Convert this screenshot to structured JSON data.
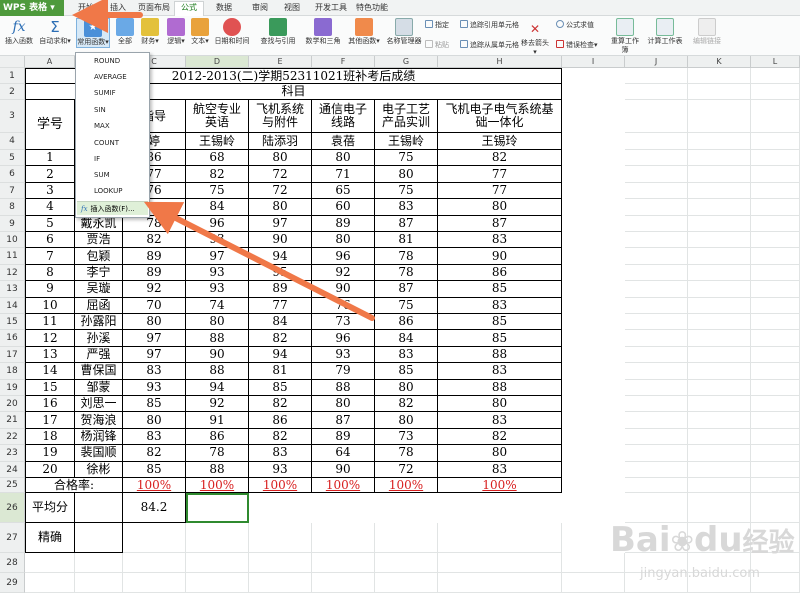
{
  "app": {
    "brand": "WPS 表格"
  },
  "menu_tabs": [
    "开始",
    "插入",
    "页面布局",
    "公式",
    "数据",
    "审阅",
    "视图",
    "开发工具",
    "特色功能"
  ],
  "active_tab": "公式",
  "ribbon": {
    "insert_fn": "插入函数",
    "autosum": "自动求和",
    "common_fn": "常用函数",
    "all_fn": "全部",
    "finance": "财务",
    "logic": "逻辑",
    "text": "文本",
    "datetime": "日期和时间",
    "lookup": "查找与引用",
    "math": "数学和三角",
    "other": "其他函数",
    "name_mgr": "名称管理器",
    "specify": "指定",
    "paste": "粘贴",
    "trace_prec": "追踪引用单元格",
    "trace_dep": "追踪从属单元格",
    "remove_arrows": "移去箭头",
    "show_formula": "公式求值",
    "error_check": "错误检查",
    "recalc": "重算工作簿",
    "calc_sheet": "计算工作表",
    "edit_link": "编辑链接"
  },
  "dropdown": {
    "items": [
      "ROUND",
      "AVERAGE",
      "SUMIF",
      "SIN",
      "MAX",
      "COUNT",
      "IF",
      "SUM",
      "LOOKUP"
    ],
    "insert_label": "插入函数(F)...",
    "fx": "fx"
  },
  "columns": [
    "A",
    "B",
    "C",
    "D",
    "E",
    "F",
    "G",
    "H",
    "I",
    "J",
    "K",
    "L"
  ],
  "rows": [
    "1",
    "2",
    "3",
    "4",
    "5",
    "6",
    "7",
    "8",
    "9",
    "10",
    "11",
    "12",
    "13",
    "14",
    "15",
    "16",
    "17",
    "18",
    "19",
    "20",
    "21",
    "22",
    "23",
    "24",
    "25",
    "26",
    "27",
    "28",
    "29"
  ],
  "sheet": {
    "title": "2012-2013(二)学期52311021班补考后成绩",
    "subject": "科目",
    "student_no": "学号",
    "c3": "指导",
    "c4": "婷",
    "subjects": [
      "航空专业\n英语",
      "飞机系统\n与附件",
      "通信电子\n线路",
      "电子工艺\n产品实训",
      "飞机电子电气系统基\n础一体化"
    ],
    "teachers": [
      "王锡岭",
      "陆添羽",
      "袁蓓",
      "王锡岭",
      "王锡玲"
    ],
    "data": [
      {
        "no": "1",
        "name": "",
        "c": "86",
        "d": "68",
        "e": "80",
        "f": "80",
        "g": "75",
        "h": "82"
      },
      {
        "no": "2",
        "name": "",
        "c": "77",
        "d": "82",
        "e": "72",
        "f": "71",
        "g": "80",
        "h": "77"
      },
      {
        "no": "3",
        "name": "",
        "c": "76",
        "d": "75",
        "e": "72",
        "f": "65",
        "g": "75",
        "h": "77"
      },
      {
        "no": "4",
        "name": "",
        "c": "",
        "d": "84",
        "e": "80",
        "f": "60",
        "g": "83",
        "h": "80"
      },
      {
        "no": "5",
        "name": "戴永凯",
        "c": "78",
        "d": "96",
        "e": "97",
        "f": "89",
        "g": "87",
        "h": "87"
      },
      {
        "no": "6",
        "name": "贾浩",
        "c": "82",
        "d": "93",
        "e": "90",
        "f": "80",
        "g": "81",
        "h": "83"
      },
      {
        "no": "7",
        "name": "包颖",
        "c": "89",
        "d": "97",
        "e": "94",
        "f": "96",
        "g": "78",
        "h": "90"
      },
      {
        "no": "8",
        "name": "李宁",
        "c": "89",
        "d": "93",
        "e": "95",
        "f": "92",
        "g": "78",
        "h": "86"
      },
      {
        "no": "9",
        "name": "吴璇",
        "c": "92",
        "d": "93",
        "e": "89",
        "f": "90",
        "g": "87",
        "h": "85"
      },
      {
        "no": "10",
        "name": "屈函",
        "c": "70",
        "d": "74",
        "e": "77",
        "f": "76",
        "g": "75",
        "h": "83"
      },
      {
        "no": "11",
        "name": "孙露阳",
        "c": "80",
        "d": "80",
        "e": "84",
        "f": "73",
        "g": "86",
        "h": "85"
      },
      {
        "no": "12",
        "name": "孙溪",
        "c": "97",
        "d": "88",
        "e": "82",
        "f": "96",
        "g": "84",
        "h": "85"
      },
      {
        "no": "13",
        "name": "严强",
        "c": "97",
        "d": "90",
        "e": "94",
        "f": "93",
        "g": "83",
        "h": "88"
      },
      {
        "no": "14",
        "name": "曹保国",
        "c": "83",
        "d": "88",
        "e": "81",
        "f": "79",
        "g": "85",
        "h": "83"
      },
      {
        "no": "15",
        "name": "邹蒙",
        "c": "93",
        "d": "94",
        "e": "85",
        "f": "88",
        "g": "80",
        "h": "88"
      },
      {
        "no": "16",
        "name": "刘思一",
        "c": "85",
        "d": "92",
        "e": "82",
        "f": "80",
        "g": "82",
        "h": "80"
      },
      {
        "no": "17",
        "name": "贺海浪",
        "c": "80",
        "d": "91",
        "e": "86",
        "f": "87",
        "g": "80",
        "h": "83"
      },
      {
        "no": "18",
        "name": "杨润锋",
        "c": "83",
        "d": "86",
        "e": "82",
        "f": "89",
        "g": "73",
        "h": "82"
      },
      {
        "no": "19",
        "name": "裴国顺",
        "c": "82",
        "d": "78",
        "e": "83",
        "f": "64",
        "g": "78",
        "h": "80"
      },
      {
        "no": "20",
        "name": "徐彬",
        "c": "85",
        "d": "88",
        "e": "93",
        "f": "90",
        "g": "72",
        "h": "83"
      }
    ],
    "pass_label": "合格率:",
    "pass_rates": [
      "100%",
      "100%",
      "100%",
      "100%",
      "100%",
      "100%"
    ],
    "avg_label": "平均分",
    "avg_value": "84.2",
    "precise_label": "精确"
  },
  "watermark": {
    "big": "Bai",
    "paw": "du",
    "cn": "经验",
    "url": "jingyan.baidu.com"
  },
  "colors": {
    "accent": "#4e9a3c",
    "arrow": "#f07848",
    "red": "#d81e1e",
    "selection": "#2f8a2f"
  }
}
